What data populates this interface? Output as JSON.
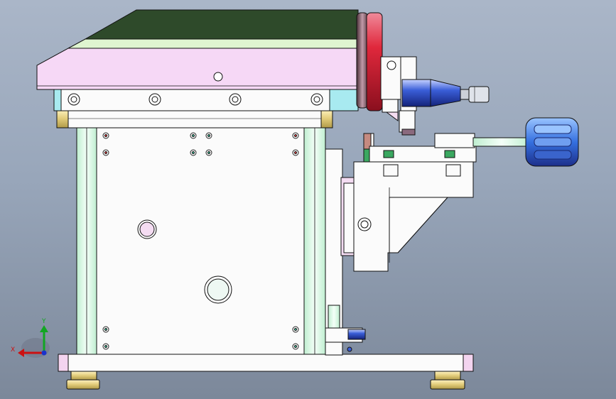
{
  "viewport": {
    "background_top": "#aab6c8",
    "background_bottom": "#7c889a"
  },
  "triad": {
    "x_label": "X",
    "y_label": "Y",
    "x_color": "#cc1111",
    "y_color": "#11a622",
    "z_color": "#1a33cc"
  },
  "model": {
    "name": "",
    "colors": {
      "top_table": "#2e4a2a",
      "slide_plate": "#f6d8f6",
      "rail": "#d8f2e2",
      "body_panel": "#fbfbfb",
      "brass": "#e9d58a",
      "handwheel_red": "#e0283c",
      "knob_blue": "#3a5ed8",
      "cyan_edge": "#a8eaf0"
    }
  }
}
